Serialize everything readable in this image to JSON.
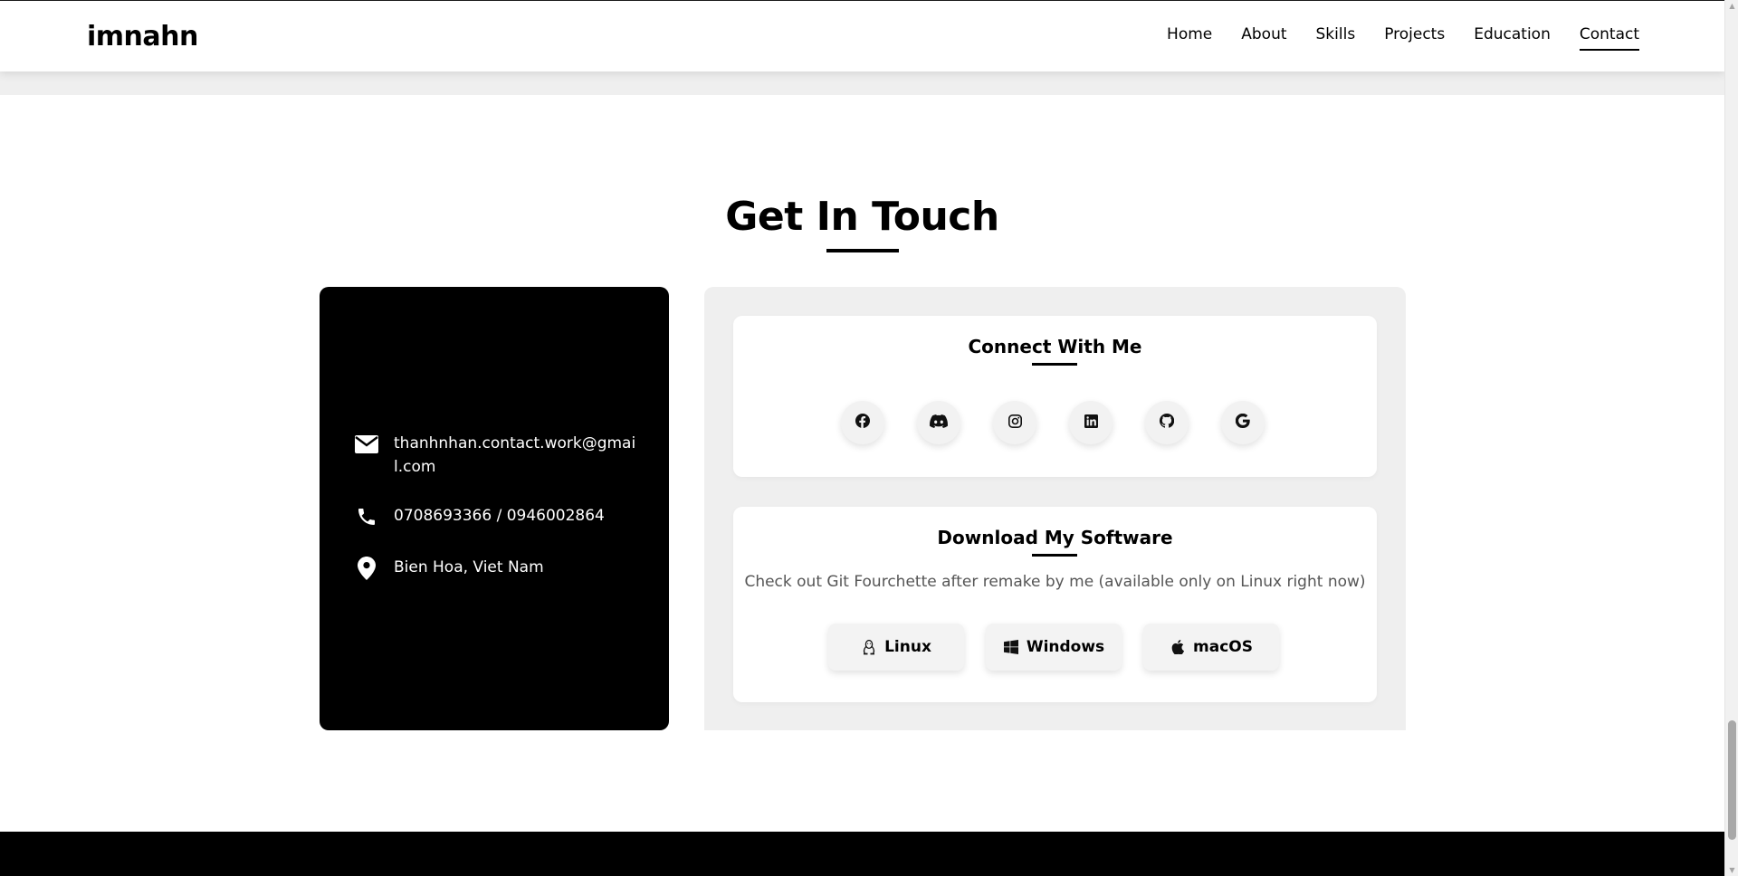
{
  "header": {
    "logo": "imnahn",
    "nav": [
      {
        "label": "Home"
      },
      {
        "label": "About"
      },
      {
        "label": "Skills"
      },
      {
        "label": "Projects"
      },
      {
        "label": "Education"
      },
      {
        "label": "Contact",
        "active": true
      }
    ]
  },
  "contact": {
    "title": "Get In Touch",
    "info": {
      "email": "thanhnhan.contact.work@gmail.com",
      "phone": "0708693366 / 0946002864",
      "location": "Bien Hoa, Viet Nam"
    },
    "connect": {
      "title": "Connect With Me",
      "socials": [
        {
          "icon": "facebook-icon"
        },
        {
          "icon": "discord-icon"
        },
        {
          "icon": "instagram-icon"
        },
        {
          "icon": "linkedin-icon"
        },
        {
          "icon": "github-icon"
        },
        {
          "icon": "google-icon"
        }
      ]
    },
    "download": {
      "title": "Download My Software",
      "description": "Check out Git Fourchette after remake by me (available only on Linux right now)",
      "buttons": [
        {
          "label": "Linux",
          "icon": "linux-icon"
        },
        {
          "label": "Windows",
          "icon": "windows-icon"
        },
        {
          "label": "macOS",
          "icon": "apple-icon"
        }
      ]
    }
  },
  "colors": {
    "primary": "#000000",
    "panel": "#efefef",
    "card": "#ffffff",
    "muted_text": "#555555"
  }
}
